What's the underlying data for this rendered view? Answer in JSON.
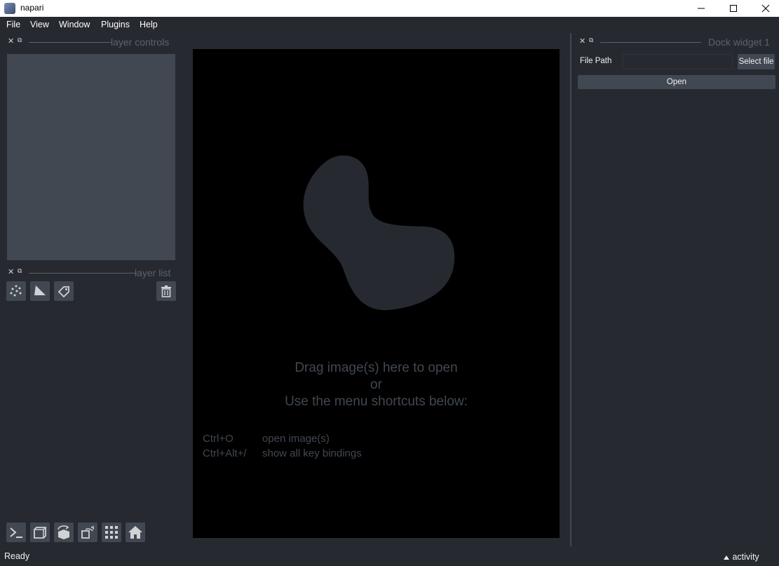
{
  "window": {
    "title": "napari"
  },
  "menubar": [
    "File",
    "View",
    "Window",
    "Plugins",
    "Help"
  ],
  "layer_controls": {
    "title": "layer controls"
  },
  "layer_list": {
    "title": "layer list"
  },
  "dock_widget": {
    "title": "Dock widget 1",
    "file_path_label": "File Path",
    "file_path_value": "",
    "select_file_label": "Select file",
    "open_label": "Open"
  },
  "canvas": {
    "line1": "Drag image(s) here to open",
    "line2": "or",
    "line3": "Use the menu shortcuts below:",
    "shortcuts": [
      {
        "key": "Ctrl+O",
        "desc": "open image(s)"
      },
      {
        "key": "Ctrl+Alt+/",
        "desc": "show all key bindings"
      }
    ]
  },
  "status": {
    "text": "Ready",
    "activity_label": "activity"
  },
  "icons": {
    "layer_buttons": [
      "new-points-icon",
      "new-shapes-icon",
      "new-labels-icon",
      "delete-layer-icon"
    ],
    "viewer_buttons": [
      "console-icon",
      "ndisplay-icon",
      "roll-dims-icon",
      "transpose-icon",
      "grid-icon",
      "home-icon"
    ]
  },
  "colors": {
    "background": "#262930",
    "panel": "#414851",
    "canvas": "#000000",
    "text": "#d1d2d4"
  }
}
